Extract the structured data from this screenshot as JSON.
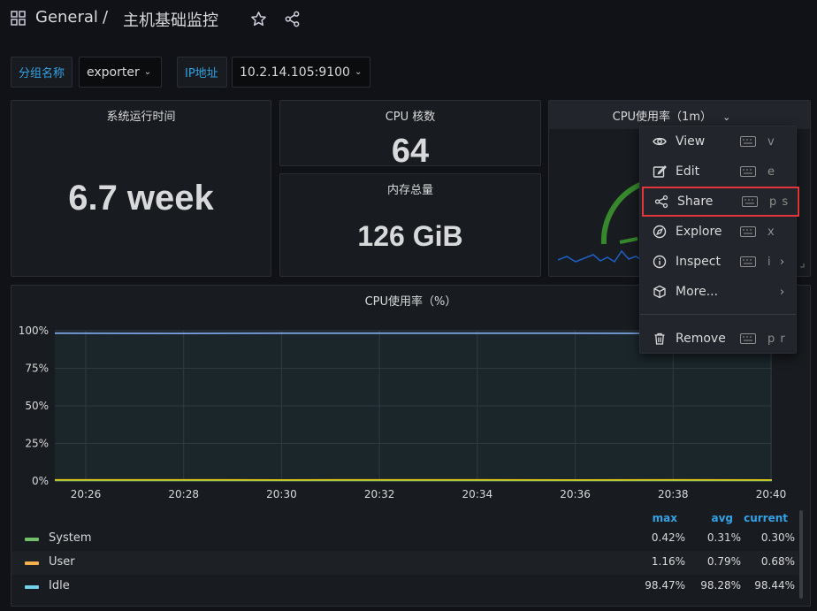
{
  "breadcrumb": {
    "folder": "General",
    "separator": "/",
    "dashboard": "主机基础监控"
  },
  "variables": [
    {
      "label": "分组名称",
      "value": "exporter"
    },
    {
      "label": "IP地址",
      "value": "10.2.14.105:9100"
    }
  ],
  "panels": {
    "uptime": {
      "title": "系统运行时间",
      "value": "6.7 week"
    },
    "cpu_cores": {
      "title": "CPU 核数",
      "value": "64"
    },
    "memory": {
      "title": "内存总量",
      "value": "126 GiB"
    },
    "cpu_gauge": {
      "title": "CPU使用率（1m）"
    },
    "cpu_graph": {
      "title": "CPU使用率（%）"
    }
  },
  "menu": {
    "items": [
      {
        "label": "View",
        "shortcut": "v",
        "icon": "eye-icon"
      },
      {
        "label": "Edit",
        "shortcut": "e",
        "icon": "edit-icon"
      },
      {
        "label": "Share",
        "shortcut": "p s",
        "icon": "share-icon"
      },
      {
        "label": "Explore",
        "shortcut": "x",
        "icon": "compass-icon"
      },
      {
        "label": "Inspect",
        "shortcut": "i",
        "icon": "info-icon",
        "submenu": "›"
      },
      {
        "label": "More...",
        "shortcut": "",
        "icon": "cube-icon",
        "submenu": "›"
      },
      {
        "label": "Remove",
        "shortcut": "p r",
        "icon": "trash-icon"
      }
    ]
  },
  "chart_data": {
    "type": "line",
    "x": [
      "20:26",
      "20:28",
      "20:30",
      "20:32",
      "20:34",
      "20:36",
      "20:38",
      "20:40"
    ],
    "y_ticks": [
      "100%",
      "75%",
      "50%",
      "25%",
      "0%"
    ],
    "ylim": [
      0,
      100
    ],
    "series": [
      {
        "name": "System",
        "color": "#73bf69",
        "values": [
          0.3,
          0.3,
          0.3,
          0.3,
          0.3,
          0.3,
          0.3,
          0.3
        ]
      },
      {
        "name": "User",
        "color": "#f2cc0c",
        "values": [
          0.8,
          0.8,
          0.7,
          0.8,
          0.8,
          0.7,
          0.8,
          0.7
        ]
      },
      {
        "name": "Idle",
        "color": "#8ab8ff",
        "values": [
          98.3,
          98.2,
          98.3,
          98.3,
          98.3,
          98.3,
          98.2,
          98.4
        ]
      }
    ]
  },
  "legend": {
    "headers": {
      "max": "max",
      "avg": "avg",
      "current": "current"
    },
    "rows": [
      {
        "name": "System",
        "color": "#73bf69",
        "max": "0.42%",
        "avg": "0.31%",
        "current": "0.30%"
      },
      {
        "name": "User",
        "color": "#f2cc0c",
        "max": "1.16%",
        "avg": "0.79%",
        "current": "0.68%"
      },
      {
        "name": "Idle",
        "color": "#73d0e8",
        "max": "98.47%",
        "avg": "98.28%",
        "current": "98.44%"
      }
    ]
  }
}
